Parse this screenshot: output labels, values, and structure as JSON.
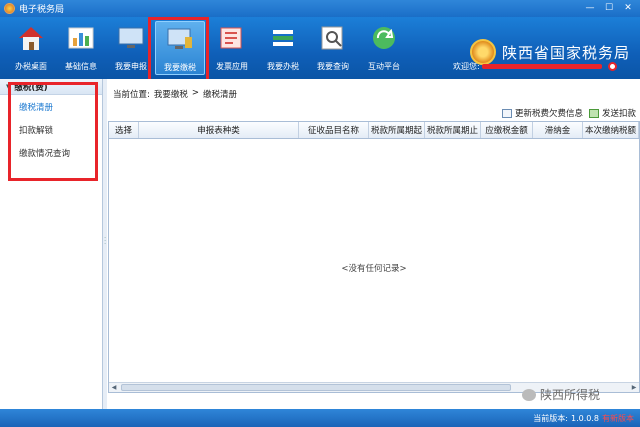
{
  "window": {
    "title": "电子税务局"
  },
  "toolbar": {
    "buttons": [
      {
        "label": "办税桌面",
        "icon": "house-icon",
        "color": "#c0392b"
      },
      {
        "label": "基础信息",
        "icon": "bar-chart-icon",
        "color": "#e6a23c"
      },
      {
        "label": "我要申报",
        "icon": "monitor-icon",
        "color": "#5a8fc8"
      },
      {
        "label": "我要缴税",
        "icon": "monitor-money-icon",
        "color": "#5a8fc8"
      },
      {
        "label": "发票应用",
        "icon": "invoice-icon",
        "color": "#d9534f"
      },
      {
        "label": "我要办税",
        "icon": "stack-icon",
        "color": "#3a3a3a"
      },
      {
        "label": "我要查询",
        "icon": "magnifier-icon",
        "color": "#777"
      },
      {
        "label": "互动平台",
        "icon": "refresh-icon",
        "color": "#3aa655"
      }
    ],
    "active_index": 3
  },
  "brand": {
    "name": "陕西省国家税务局"
  },
  "welcome": {
    "label": "欢迎您:"
  },
  "left_panel": {
    "header": "缴税(费)",
    "items": [
      {
        "label": "缴税清册"
      },
      {
        "label": "扣款解锁"
      },
      {
        "label": "缴款情况查询"
      }
    ]
  },
  "breadcrumb": {
    "prefix": "当前位置:",
    "level1": "我要缴税",
    "sep": ">",
    "level2": "缴税清册"
  },
  "actions": {
    "refresh": "更新税费欠费信息",
    "deduct": "发送扣款"
  },
  "grid": {
    "columns": [
      "选择",
      "申报表种类",
      "征收品目名称",
      "税款所属期起",
      "税款所属期止",
      "应缴税金额",
      "滞纳金",
      "本次缴纳税额"
    ],
    "empty_text": "<没有任何记录>"
  },
  "watermark": {
    "text": "陕西所得税"
  },
  "status": {
    "version_label": "当前版本:",
    "version": "1.0.0.8",
    "note": "有新版本"
  },
  "colors": {
    "accent": "#1a6ec7",
    "highlight": "#e8242a"
  }
}
